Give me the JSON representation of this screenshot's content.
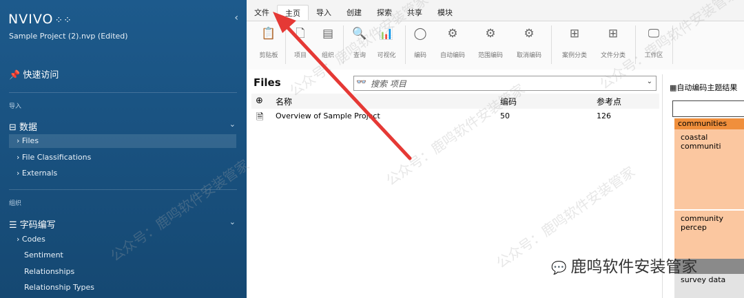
{
  "app": {
    "logo": "NVIVO",
    "logo_mark": "⁘⁘",
    "project": "Sample Project (2).nvp (Edited)"
  },
  "sidebar": {
    "quick_access": "快速访问",
    "group_import": "导入",
    "data_section": "数据",
    "data_items": [
      "Files",
      "File Classifications",
      "Externals"
    ],
    "group_organize": "组织",
    "coding_section": "字码编写",
    "coding_items": [
      "Codes",
      "Sentiment",
      "Relationships",
      "Relationship Types"
    ]
  },
  "ribbon": {
    "tabs": [
      "文件",
      "主页",
      "导入",
      "创建",
      "探索",
      "共享",
      "模块"
    ],
    "active_tab": "主页",
    "buttons": [
      "剪贴板",
      "项目",
      "组织",
      "查询",
      "可视化",
      "编码",
      "自动编码",
      "范围编码",
      "取消编码",
      "案例分类",
      "文件分类",
      "工作区"
    ]
  },
  "files": {
    "title": "Files",
    "search_placeholder": "搜索 项目",
    "columns": {
      "name": "名称",
      "codes": "编码",
      "refs": "参考点"
    },
    "rows": [
      {
        "name": "Overview of Sample Project",
        "codes": "50",
        "refs": "126"
      }
    ]
  },
  "right_panel": {
    "title": "自动编码主题结果",
    "tiles": [
      "communities",
      "coastal communiti",
      "community percep",
      "survey data"
    ]
  },
  "watermark": {
    "text": "公众号：鹿鸣软件安装管家",
    "brand": "鹿鸣软件安装管家"
  }
}
